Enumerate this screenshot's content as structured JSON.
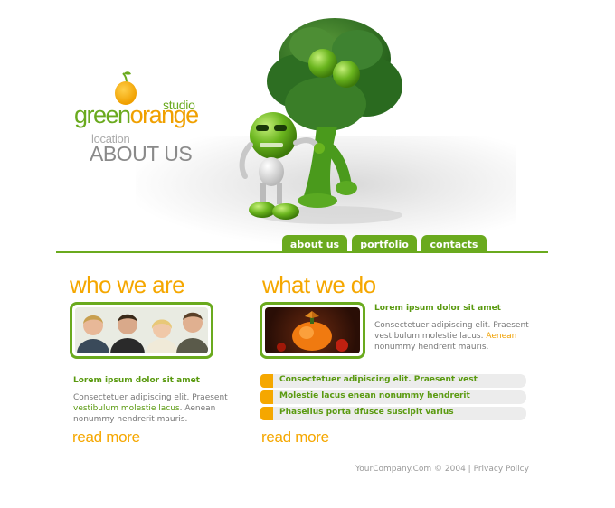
{
  "logo": {
    "studio": "studio",
    "name_green": "green",
    "name_orange": "orange",
    "location_label": "location",
    "page_title": "ABOUT US"
  },
  "nav": {
    "tabs": [
      {
        "label": "about us"
      },
      {
        "label": "portfolio"
      },
      {
        "label": "contacts"
      }
    ]
  },
  "who_we_are": {
    "heading": "who we are",
    "subhead": "Lorem ipsum dolor sit amet",
    "text_before": "Consectetuer adipiscing elit. Praesent ",
    "text_link": "vestibulum molestie lacus",
    "text_after": ". Aenean nonummy hendrerit mauris.",
    "read_more": "read more"
  },
  "what_we_do": {
    "heading": "what we do",
    "subhead": "Lorem ipsum dolor sit amet",
    "text_before": "Consectetuer adipiscing elit. Praesent vestibulum molestie lacus. ",
    "text_link": "Aenean",
    "text_after": " nonummy hendrerit mauris.",
    "list": [
      "Consectetuer adipiscing elit. Praesent vest",
      "Molestie lacus enean nonummy hendrerit",
      "Phasellus porta dfusce suscipit varius"
    ],
    "read_more": "read more"
  },
  "footer": {
    "copyright": "YourCompany.Com © 2004",
    "separator": " | ",
    "privacy": "Privacy Policy"
  },
  "colors": {
    "green": "#6aaa1e",
    "orange": "#f5a700",
    "text": "#777777"
  }
}
